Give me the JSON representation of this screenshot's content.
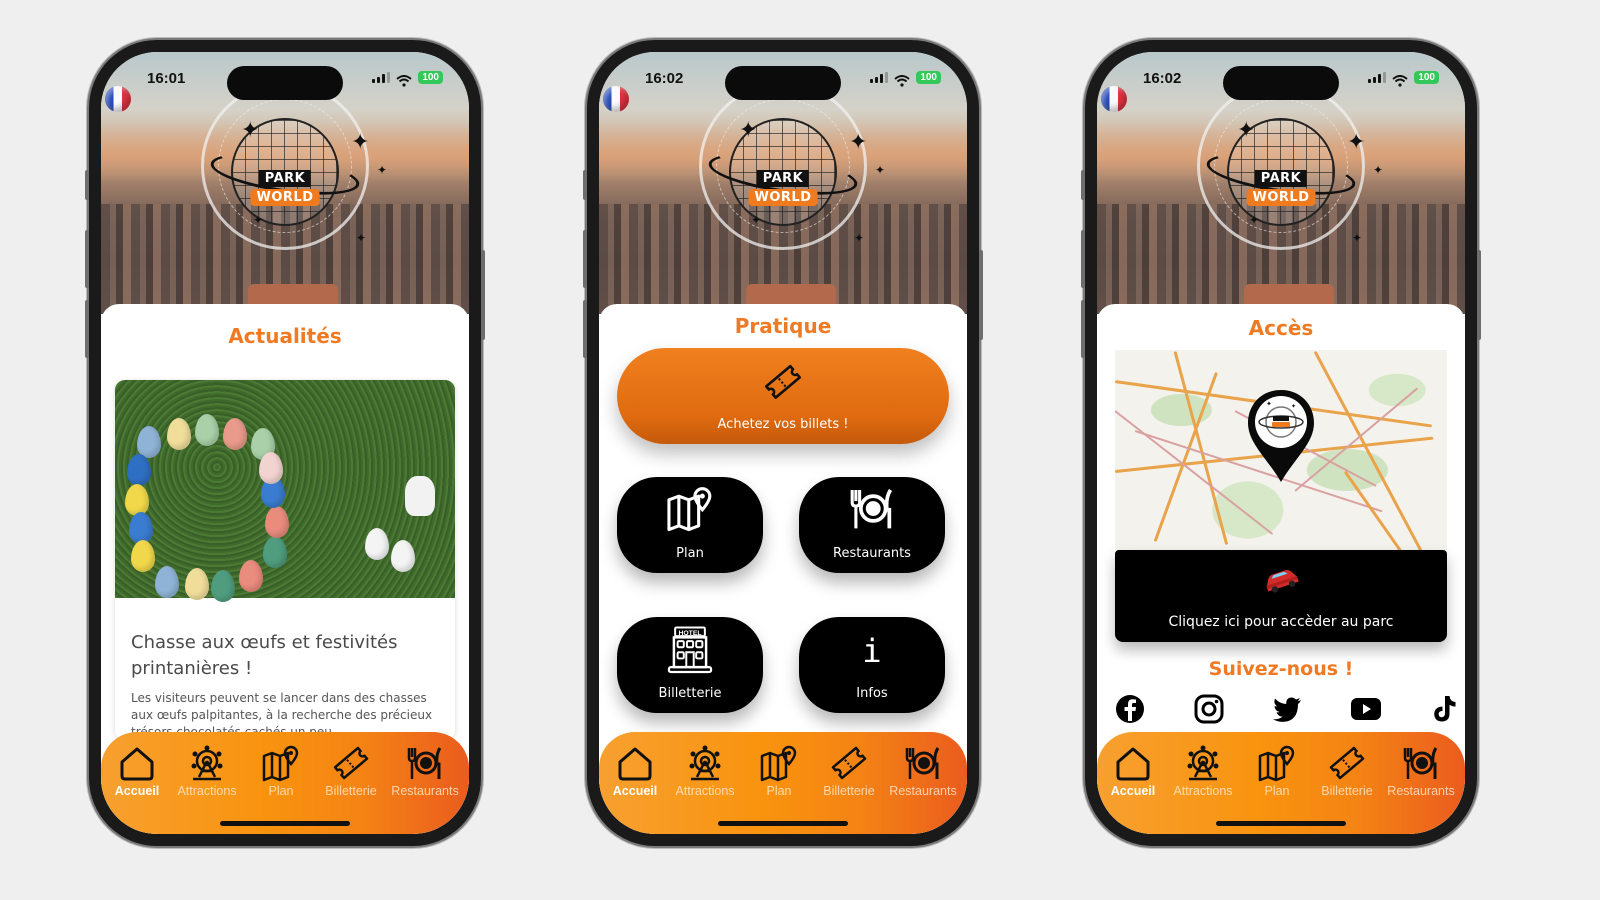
{
  "app": {
    "brand_top": "PARK",
    "brand_bottom": "WORLD",
    "accent_color": "#ef7a23",
    "tabbar_gradient": [
      "#f7a030",
      "#ea5c1e"
    ]
  },
  "screens": [
    {
      "status": {
        "time": "16:01",
        "battery": "100"
      },
      "section_title": "Actualités",
      "news": {
        "title": "Chasse aux œufs et festivités printanières !",
        "body": "Les visiteurs peuvent se lancer dans des chasses aux œufs palpitantes, à la recherche des précieux trésors chocolatés cachés un peu"
      }
    },
    {
      "status": {
        "time": "16:02",
        "battery": "100"
      },
      "section_title": "Pratique",
      "cta": {
        "label": "Achetez vos billets !",
        "icon": "ticket-icon"
      },
      "tiles": [
        {
          "label": "Plan",
          "icon": "map-pin-icon"
        },
        {
          "label": "Restaurants",
          "icon": "plate-cutlery-icon"
        },
        {
          "label": "Billetterie",
          "icon": "hotel-icon"
        },
        {
          "label": "Infos",
          "icon": "info-icon"
        }
      ]
    },
    {
      "status": {
        "time": "16:02",
        "battery": "100"
      },
      "section_title": "Accès",
      "access": {
        "label": "Cliquez ici pour accèder au parc",
        "icon": "car-icon"
      },
      "follow_title": "Suivez-nous !",
      "socials": [
        "facebook",
        "instagram",
        "twitter",
        "youtube",
        "tiktok"
      ]
    }
  ],
  "tabs": [
    {
      "label": "Accueil",
      "icon": "home-icon",
      "active": true
    },
    {
      "label": "Attractions",
      "icon": "ferris-wheel-icon"
    },
    {
      "label": "Plan",
      "icon": "map-pin-icon"
    },
    {
      "label": "Billetterie",
      "icon": "ticket-icon"
    },
    {
      "label": "Restaurants",
      "icon": "plate-cutlery-icon"
    }
  ]
}
